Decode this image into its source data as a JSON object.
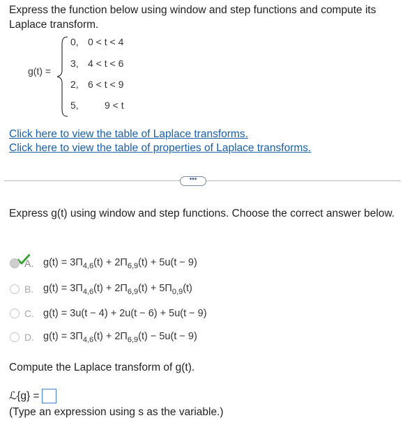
{
  "question": {
    "text": "Express the function below using window and step functions and compute its Laplace transform."
  },
  "function": {
    "label": "g(t) =",
    "cases": [
      {
        "value": "0,",
        "condition": "0 < t < 4"
      },
      {
        "value": "3,",
        "condition": "4 < t < 6"
      },
      {
        "value": "2,",
        "condition": "6 < t < 9"
      },
      {
        "value": "5,",
        "condition": "9 < t"
      }
    ]
  },
  "links": {
    "transforms": "Click here to view the table of Laplace transforms.",
    "properties": "Click here to view the table of properties of Laplace transforms."
  },
  "more_button": "•••",
  "part1": {
    "prompt": "Express g(t) using window and step functions. Choose the correct answer below.",
    "selected": "A",
    "options": [
      {
        "letter": "A.",
        "p1": "g(t) = 3Π",
        "s1": "4,6",
        "p2": "(t) + 2Π",
        "s2": "6,9",
        "p3": "(t) + 5u(t − 9)",
        "s3": "",
        "p4": ""
      },
      {
        "letter": "B.",
        "p1": "g(t) = 3Π",
        "s1": "4,6",
        "p2": "(t) + 2Π",
        "s2": "6,9",
        "p3": "(t) + 5Π",
        "s3": "0,9",
        "p4": "(t)"
      },
      {
        "letter": "C.",
        "p1": "g(t) = 3u(t − 4) + 2u(t − 6) + 5u(t − 9)",
        "s1": "",
        "p2": "",
        "s2": "",
        "p3": "",
        "s3": "",
        "p4": ""
      },
      {
        "letter": "D.",
        "p1": "g(t) = 3Π",
        "s1": "4,6",
        "p2": "(t) + 2Π",
        "s2": "6,9",
        "p3": "(t) − 5u(t − 9)",
        "s3": "",
        "p4": ""
      }
    ]
  },
  "part2": {
    "prompt": "Compute the Laplace transform of g(t).",
    "label": "ℒ{g} =",
    "answer_value": "",
    "hint": "(Type an expression using s as the variable.)"
  },
  "colors": {
    "link": "#1a5fa8",
    "check": "#3aa335",
    "answer_border": "#3f7fd3"
  },
  "icons": {
    "check": "checkmark-icon",
    "radio": "radio-button"
  }
}
